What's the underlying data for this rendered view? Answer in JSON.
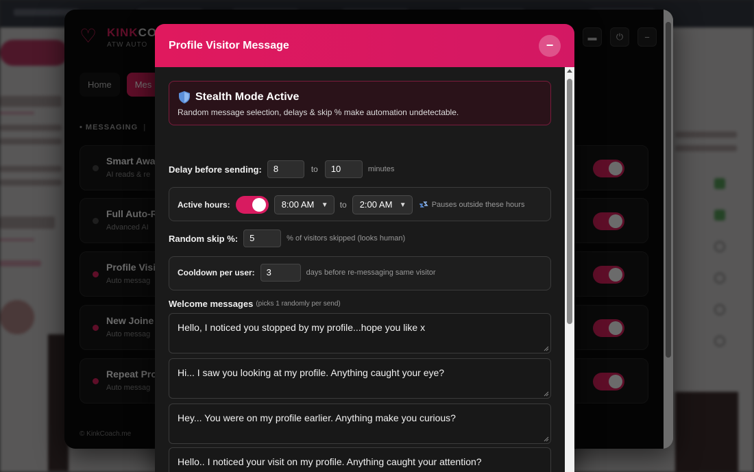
{
  "popup": {
    "brand_a": "KINK",
    "brand_b": "CO",
    "subtitle": "ATW AUTO",
    "tabs": [
      "Home",
      "Mes"
    ],
    "section": "• MESSAGING",
    "section_sep": "|",
    "cards": [
      {
        "title": "Smart Awa",
        "sub": "AI reads & re"
      },
      {
        "title": "Full Auto-R",
        "sub": "Advanced AI"
      },
      {
        "title": "Profile Visi",
        "sub": "Auto messag"
      },
      {
        "title": "New Joine",
        "sub": "Auto messag"
      },
      {
        "title": "Repeat Pro",
        "sub": "Auto messag"
      }
    ],
    "footer": "© KinkCoach.me"
  },
  "modal": {
    "title": "Profile Visitor Message",
    "close_label": "−",
    "stealth": {
      "title": "Stealth Mode Active",
      "desc": "Random message selection, delays & skip % make automation undetectable."
    },
    "delay": {
      "label": "Delay before sending:",
      "min": "8",
      "to": "to",
      "max": "10",
      "unit": "minutes"
    },
    "active_hours": {
      "label": "Active hours:",
      "enabled": true,
      "start": "8:00 AM",
      "to": "to",
      "end": "2:00 AM",
      "hint": "Pauses outside these hours"
    },
    "skip": {
      "label": "Random skip %:",
      "value": "5",
      "hint": "% of visitors skipped (looks human)"
    },
    "cooldown": {
      "label": "Cooldown per user:",
      "value": "3",
      "hint": "days before re-messaging same visitor"
    },
    "welcome": {
      "label": "Welcome messages",
      "hint": "(picks 1 randomly per send)",
      "messages": [
        "Hello, I noticed you stopped by my profile...hope you like x",
        "Hi... I saw you looking at my profile. Anything caught your eye?",
        "Hey... You were on my profile earlier. Anything make you curious?",
        "Hello.. I noticed your visit on my profile. Anything caught your attention?"
      ]
    }
  },
  "colors": {
    "accent": "#d81b60",
    "modal_bg": "#1a1a1a"
  }
}
